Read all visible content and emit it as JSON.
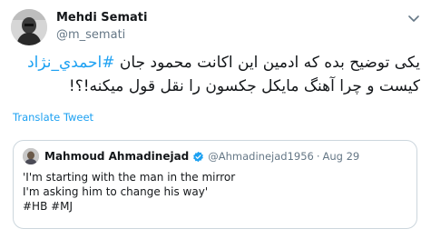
{
  "tweet": {
    "display_name": "Mehdi Semati",
    "handle": "@m_semati",
    "text_before": "یکی توضیح بده که ادمین این اکانت محمود جان ",
    "hashtag": "#احمدي_نژاد",
    "text_after": " کیست و چرا آهنگ مایکل جکسون را نقل قول میکنه!؟!",
    "translate_label": "Translate Tweet"
  },
  "quoted_tweet": {
    "display_name": "Mahmoud Ahmadinejad",
    "handle": "@Ahmadinejad1956",
    "separator": "·",
    "date": "Aug 29",
    "lines": [
      "'I'm starting with the man in the mirror",
      "I'm asking him to change his way'"
    ],
    "hashtags": "#HB #MJ"
  },
  "colors": {
    "link": "#1da1f2",
    "text": "#14171a",
    "secondary": "#657786",
    "border": "#ccd6dd"
  },
  "icons": {
    "more": "chevron-down-icon",
    "verified": "verified-badge-icon"
  }
}
